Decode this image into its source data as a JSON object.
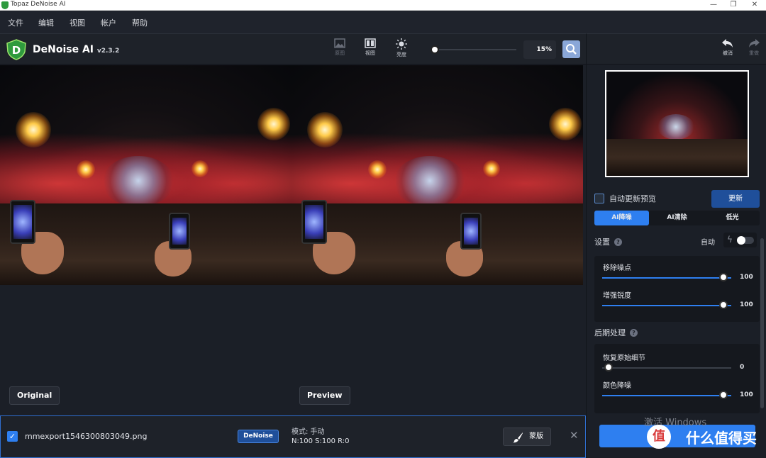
{
  "window": {
    "title": "Topaz DeNoise AI",
    "controls": [
      "—",
      "❐",
      "✕"
    ]
  },
  "menu": [
    "文件",
    "编辑",
    "视图",
    "帐户",
    "帮助"
  ],
  "app": {
    "name": "DeNoise AI",
    "version": "v2.3.2"
  },
  "toolbar": {
    "image_label": "原图",
    "view_label": "视图",
    "brightness_label": "亮度",
    "zoom_value": "15%",
    "undo_label": "撤消",
    "redo_label": "重做"
  },
  "canvas": {
    "original_label": "Original",
    "preview_label": "Preview"
  },
  "file": {
    "checked": true,
    "name": "mmexport1546300803049.png",
    "badge": "DeNoise",
    "mode_text": "模式: 手动",
    "n_label": "N:",
    "n_value": "100",
    "s_label": "S:",
    "s_value": "100",
    "r_label": "R:",
    "r_value": "0",
    "mask_label": "蒙版",
    "close_icon": "✕"
  },
  "panel": {
    "auto_update_label": "自动更新预览",
    "update_button": "更新",
    "tabs": [
      "AI降噪",
      "AI清除",
      "低光"
    ],
    "active_tab": 0,
    "settings_label": "设置",
    "auto_label": "自动",
    "auto_enabled": false,
    "sliders": [
      {
        "label": "移除噪点",
        "value": 100
      },
      {
        "label": "增强锐度",
        "value": 100
      }
    ],
    "post_label": "后期处理",
    "post_sliders": [
      {
        "label": "恢复原始细节",
        "value": 0
      },
      {
        "label": "颜色降噪",
        "value": 100
      }
    ],
    "activate_windows": "激活 Windows",
    "watermark_brand": "什么值得买",
    "watermark_icon": "值"
  },
  "colors": {
    "accent": "#2e7ff0",
    "background": "#1b1f27"
  }
}
